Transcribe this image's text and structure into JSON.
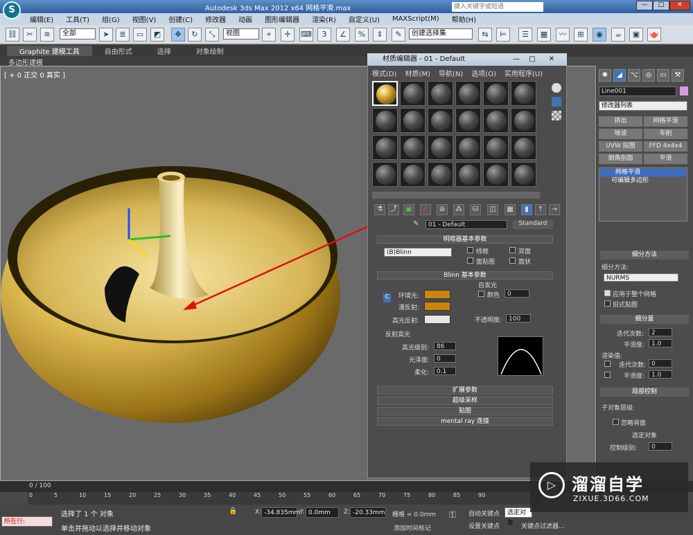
{
  "window": {
    "title": "Autodesk 3ds Max  2012 x64    网格平滑.max",
    "search_placeholder": "键入关键字或短语"
  },
  "menu": [
    "编辑(E)",
    "工具(T)",
    "组(G)",
    "视图(V)",
    "创建(C)",
    "修改器",
    "动画",
    "图形编辑器",
    "渲染(R)",
    "自定义(U)",
    "MAXScript(M)",
    "帮助(H)"
  ],
  "toolbar": {
    "selection_filter": "全部",
    "ref_coord": "视图",
    "named_selection": "创建选择集"
  },
  "ribbon": {
    "tabs": [
      "Graphite 建模工具",
      "自由形式",
      "选择",
      "对象绘制"
    ],
    "sub": "多边形建模"
  },
  "viewport": {
    "label": "[ + 0 正交 0 真实 ]"
  },
  "material_editor": {
    "title": "材质编辑器 - 01 - Default",
    "menu": [
      "模式(D)",
      "材质(M)",
      "导航(N)",
      "选项(O)",
      "实用程序(U)"
    ],
    "material_name": "01 - Default",
    "material_type": "Standard",
    "shader_section": "明暗器基本参数",
    "shader": "(B)Blinn",
    "shader_options": [
      "线框",
      "双面",
      "面贴图",
      "面状"
    ],
    "blinn_section": "Blinn 基本参数",
    "self_illum": "自发光",
    "color_label": "颜色",
    "color_value": "0",
    "ambient": "环境光:",
    "diffuse": "漫反射:",
    "specular": "高光反射:",
    "opacity_label": "不透明度:",
    "opacity_value": "100",
    "spec_section": "反射高光",
    "spec_level_label": "高光级别:",
    "spec_level": "86",
    "gloss_label": "光泽度:",
    "gloss": "0",
    "soften_label": "柔化:",
    "soften": "0.1",
    "rollouts": [
      "扩展参数",
      "超级采样",
      "贴图",
      "mental ray 连接"
    ],
    "ambient_color": "#c8860f",
    "diffuse_color": "#c8860f",
    "specular_color": "#e6e6e6"
  },
  "command_panel": {
    "object_name": "Line001",
    "modifier_list": "修改器列表",
    "buttons": [
      "挤出",
      "网格平滑",
      "噪波",
      "车削",
      "UVW 贴图",
      "FFD 4x4x4",
      "倒角剖面",
      "平滑"
    ],
    "stack": [
      "网格平滑",
      "可编辑多边形"
    ],
    "subdiv_method_section": "细分方法",
    "subdiv_method_label": "细分方法:",
    "subdiv_method": "NURMS",
    "apply_whole": "应用于整个网格",
    "old_map": "旧式贴图",
    "subdiv_amount_section": "细分量",
    "iterations_label": "迭代次数:",
    "iterations": "2",
    "smoothness_label": "平滑度:",
    "smoothness": "1.0",
    "render_values": "渲染值:",
    "render_iterations": "0",
    "render_smoothness": "1.0",
    "local_control": "局部控制",
    "sub_object_level": "子对象层级:",
    "ignore_backfacing": "忽略背面",
    "select_object": "选定对象",
    "control_level_label": "控制级别:",
    "control_level": "0"
  },
  "timeline": {
    "frame": "0 / 100",
    "ticks": [
      "0",
      "5",
      "10",
      "15",
      "20",
      "25",
      "30",
      "35",
      "40",
      "45",
      "50",
      "55",
      "60",
      "65",
      "70",
      "75",
      "80",
      "85",
      "90"
    ]
  },
  "status": {
    "message": "选择了 1 个 对象",
    "hint": "单击并拖动以选择并移动对象",
    "current": "所在行:",
    "x_label": "X:",
    "x": "-34.835mm",
    "y_label": "Y:",
    "y": "0.0mm",
    "z_label": "Z:",
    "z": "-20.33mm",
    "grid": "栅格 = 0.0mm",
    "auto_key": "自动关键点",
    "set_key": "设置关键点",
    "selected": "选定对象",
    "key_filters": "关键点过滤器...",
    "add_time_tag": "添加时间标记"
  },
  "watermark": {
    "brand": "溜溜自学",
    "url": "ZIXUE.3D66.COM"
  }
}
